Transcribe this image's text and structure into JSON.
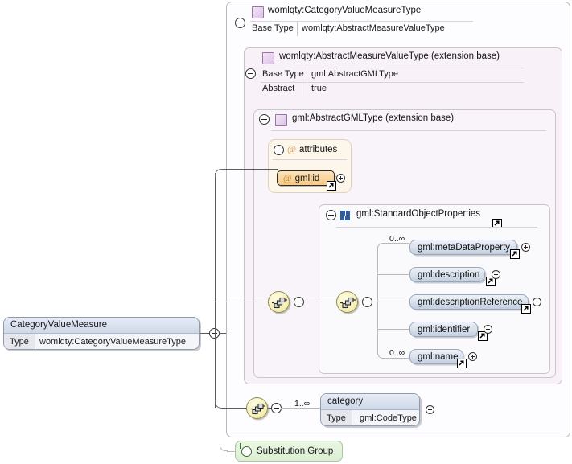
{
  "diagram": {
    "kind": "xsd-schema-element-diagram",
    "root_element": {
      "name": "CategoryValueMeasure",
      "type_key": "Type",
      "type_value": "womlqty:CategoryValueMeasureType"
    },
    "type_panels": [
      {
        "id": "category-value-measure-type",
        "title": "womlqty:CategoryValueMeasureType",
        "icon": "complex-type-icon",
        "properties": [
          {
            "key": "Base Type",
            "value": "womlqty:AbstractMeasureValueType"
          }
        ]
      },
      {
        "id": "abstract-measure-value-type",
        "title": "womlqty:AbstractMeasureValueType (extension base)",
        "icon": "complex-type-icon",
        "properties": [
          {
            "key": "Base Type",
            "value": "gml:AbstractGMLType"
          },
          {
            "key": "Abstract",
            "value": "true"
          }
        ]
      },
      {
        "id": "abstract-gml-type",
        "title": "gml:AbstractGMLType (extension base)",
        "icon": "complex-type-icon",
        "properties": []
      }
    ],
    "attributes_group": {
      "label": "attributes",
      "icon": "attribute-icon",
      "attributes": [
        {
          "name": "gml:id",
          "icon": "attribute-icon",
          "badge": "reference-arrow-icon",
          "expander": "plus"
        }
      ]
    },
    "model_group": {
      "title": "gml:StandardObjectProperties",
      "icon": "model-group-icon",
      "badge": "reference-arrow-icon",
      "elements": [
        {
          "name": "gml:metaDataProperty",
          "occurrence": "0..∞",
          "badge": "reference-arrow-icon",
          "expander": "plus"
        },
        {
          "name": "gml:description",
          "occurrence": "",
          "badge": "reference-arrow-icon",
          "expander": "plus"
        },
        {
          "name": "gml:descriptionReference",
          "occurrence": "",
          "badge": "reference-arrow-icon",
          "expander": "plus"
        },
        {
          "name": "gml:identifier",
          "occurrence": "",
          "badge": "reference-arrow-icon",
          "expander": "plus"
        },
        {
          "name": "gml:name",
          "occurrence": "0..∞",
          "badge": "reference-arrow-icon",
          "expander": "plus"
        }
      ]
    },
    "category_branch": {
      "compositor": "sequence-compositor-icon",
      "occurrence": "1..∞",
      "element": {
        "name": "category",
        "type_key": "Type",
        "type_value": "gml:CodeType",
        "expander": "plus"
      }
    },
    "substitution_group": {
      "label": "Substitution Group",
      "expander": "plus"
    },
    "compositors": [
      {
        "id": "sequence-outer",
        "icon": "sequence-compositor-icon"
      },
      {
        "id": "sequence-inner",
        "icon": "sequence-compositor-icon"
      },
      {
        "id": "sequence-category",
        "icon": "sequence-compositor-icon"
      }
    ],
    "colors": {
      "element_fill": "#dbe3ee",
      "attribute_fill": "#f7c984",
      "compositor_fill": "#f7f0b8",
      "substitution_group_fill": "#dcefd3",
      "type_icon": "#dcc3e6",
      "model_group_icon": "#2a5fa8",
      "connector": "#6e6e6e"
    }
  }
}
